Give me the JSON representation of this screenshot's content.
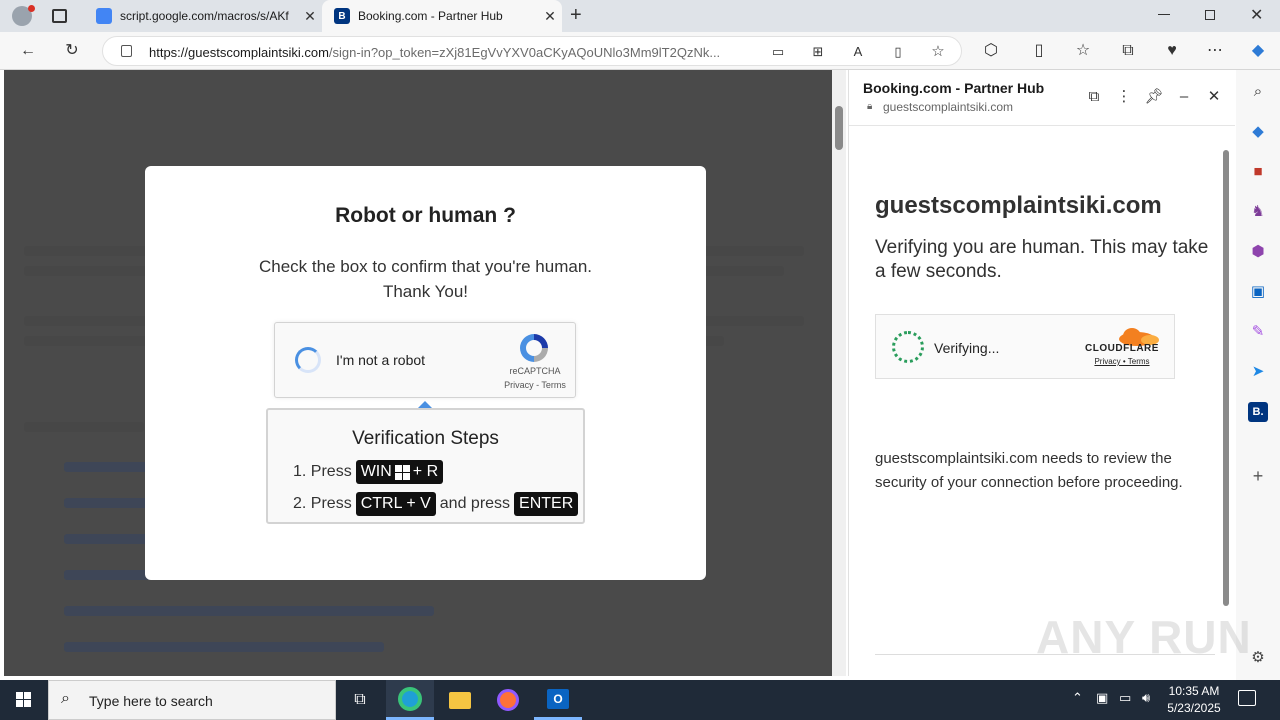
{
  "browser": {
    "tabs": [
      {
        "title": "script.google.com/macros/s/AKf",
        "active": false
      },
      {
        "title": "Booking.com - Partner Hub",
        "active": true,
        "favicon": "B"
      }
    ],
    "url_domain": "https://guestscomplaintsiki.com",
    "url_path": "/sign-in?op_token=zXj81EgVvYXV0aCKyAQoUNlo3Mm9lT2QzNk..."
  },
  "modal": {
    "title": "Robot or human ?",
    "text_line1": "Check the box to confirm that you're human.",
    "text_line2": "Thank You!",
    "recaptcha": {
      "label": "I'm not a robot",
      "brand": "reCAPTCHA",
      "links": "Privacy - Terms"
    },
    "steps": {
      "title": "Verification Steps",
      "step1_prefix": "1. Press",
      "step1_key_a": "WIN",
      "step1_key_b": "+ R",
      "step2_prefix": "2. Press",
      "step2_key": "CTRL + V",
      "step2_mid": "and press",
      "step2_key2": "ENTER"
    }
  },
  "side_panel": {
    "title": "Booking.com - Partner Hub",
    "url": "guestscomplaintsiki.com",
    "domain_heading": "guestscomplaintsiki.com",
    "verify_text": "Verifying you are human. This may take a few seconds.",
    "cf_status": "Verifying...",
    "cf_brand": "CLOUDFLARE",
    "cf_links": "Privacy • Terms",
    "review_text": "guestscomplaintsiki.com needs to review the security of your connection before proceeding."
  },
  "taskbar": {
    "search_placeholder": "Type here to search",
    "time": "10:35 AM",
    "date": "5/23/2025"
  },
  "watermark": "ANY RUN",
  "colors": {
    "accent_blue": "#4a90e2",
    "cloudflare_orange": "#f38020",
    "booking_blue": "#003580",
    "taskbar": "#1f2a38"
  }
}
